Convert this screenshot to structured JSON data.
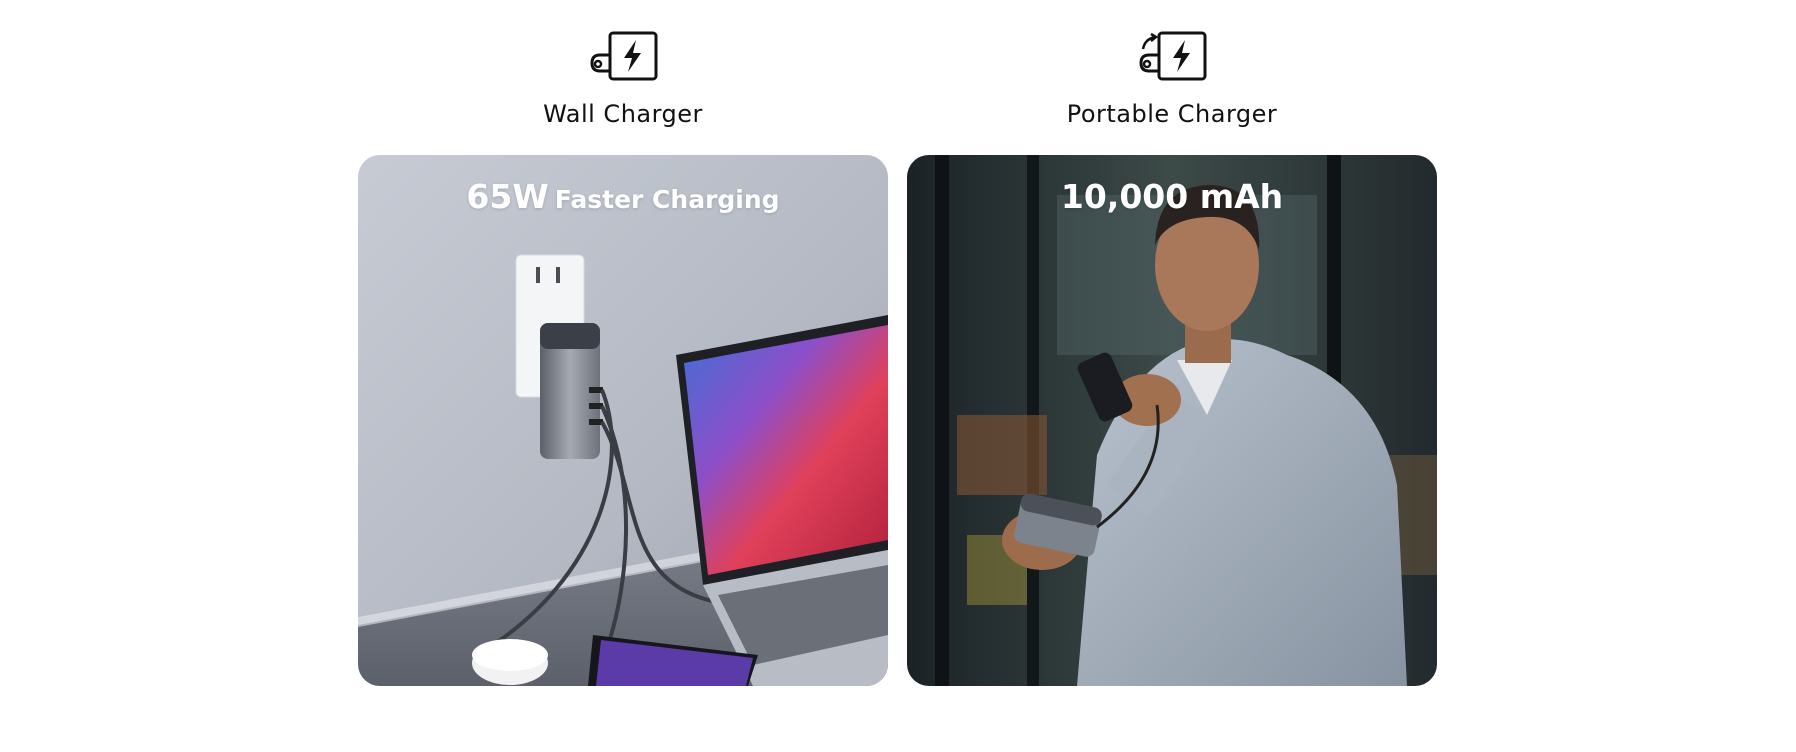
{
  "wall": {
    "icon": "wall-charger-icon",
    "label": "Wall Charger",
    "headline_value": "65W",
    "headline_text": "Faster Charging"
  },
  "portable": {
    "icon": "portable-charger-icon",
    "label": "Portable Charger",
    "headline_value": "10,000 mAh"
  },
  "colors": {
    "text": "#111111",
    "overlay_text": "#ffffff"
  }
}
